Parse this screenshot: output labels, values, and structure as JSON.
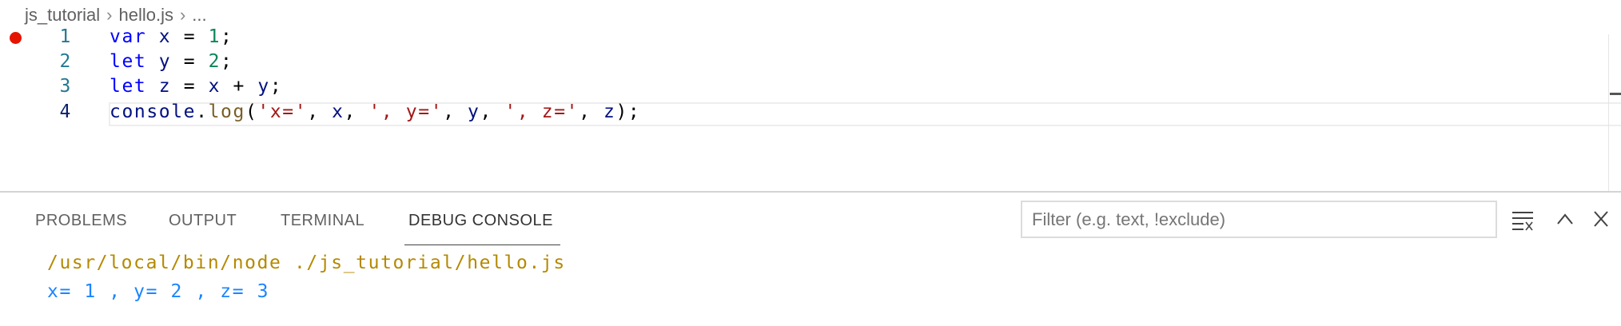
{
  "breadcrumb": {
    "items": [
      "js_tutorial",
      "hello.js",
      "..."
    ]
  },
  "editor": {
    "breakpoint_line": 1,
    "breakpoint_color": "#e51400",
    "lines": [
      {
        "number": "1",
        "tokens": [
          [
            "kw",
            "var"
          ],
          [
            "p",
            " "
          ],
          [
            "v",
            "x"
          ],
          [
            "p",
            " = "
          ],
          [
            "n",
            "1"
          ],
          [
            "p",
            ";"
          ]
        ]
      },
      {
        "number": "2",
        "tokens": [
          [
            "kw",
            "let"
          ],
          [
            "p",
            " "
          ],
          [
            "v",
            "y"
          ],
          [
            "p",
            " = "
          ],
          [
            "n",
            "2"
          ],
          [
            "p",
            ";"
          ]
        ]
      },
      {
        "number": "3",
        "tokens": [
          [
            "kw",
            "let"
          ],
          [
            "p",
            " "
          ],
          [
            "v",
            "z"
          ],
          [
            "p",
            " = "
          ],
          [
            "v",
            "x"
          ],
          [
            "p",
            " + "
          ],
          [
            "v",
            "y"
          ],
          [
            "p",
            ";"
          ]
        ]
      },
      {
        "number": "4",
        "tokens": [
          [
            "v",
            "console"
          ],
          [
            "p",
            "."
          ],
          [
            "f",
            "log"
          ],
          [
            "p",
            "("
          ],
          [
            "s",
            "'x='"
          ],
          [
            "p",
            ", "
          ],
          [
            "v",
            "x"
          ],
          [
            "p",
            ", "
          ],
          [
            "s",
            "', y='"
          ],
          [
            "p",
            ", "
          ],
          [
            "v",
            "y"
          ],
          [
            "p",
            ", "
          ],
          [
            "s",
            "', z='"
          ],
          [
            "p",
            ", "
          ],
          [
            "v",
            "z"
          ],
          [
            "p",
            ");"
          ]
        ]
      }
    ]
  },
  "panel": {
    "tabs": [
      "PROBLEMS",
      "OUTPUT",
      "TERMINAL",
      "DEBUG CONSOLE"
    ],
    "active_tab": "DEBUG CONSOLE",
    "filter_placeholder": "Filter (e.g. text, !exclude)",
    "filter_value": "",
    "icons": [
      "clear-console-icon",
      "chevron-up-icon",
      "close-icon"
    ],
    "output": [
      "/usr/local/bin/node ./js_tutorial/hello.js",
      "x= 1 , y= 2 , z= 3"
    ]
  }
}
